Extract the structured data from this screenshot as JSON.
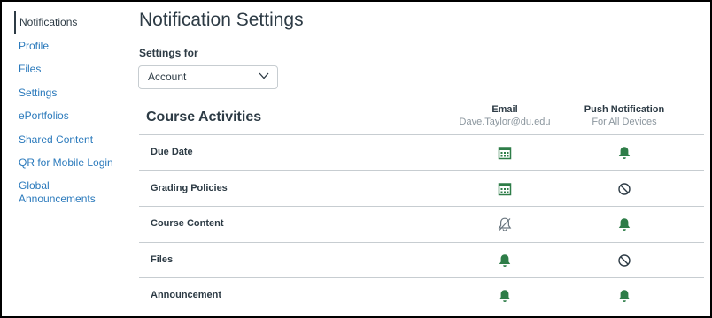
{
  "sidebar": {
    "items": [
      {
        "label": "Notifications",
        "active": true
      },
      {
        "label": "Profile"
      },
      {
        "label": "Files"
      },
      {
        "label": "Settings"
      },
      {
        "label": "ePortfolios"
      },
      {
        "label": "Shared Content"
      },
      {
        "label": "QR for Mobile Login"
      },
      {
        "label": "Global Announcements"
      }
    ]
  },
  "page": {
    "title": "Notification Settings",
    "settings_for_label": "Settings for",
    "settings_for_value": "Account"
  },
  "table": {
    "section_title": "Course Activities",
    "columns": [
      {
        "title": "Email",
        "subtitle": "Dave.Taylor@du.edu"
      },
      {
        "title": "Push Notification",
        "subtitle": "For All Devices"
      }
    ],
    "rows": [
      {
        "label": "Due Date",
        "email": "calendar-icon",
        "push": "bell-icon"
      },
      {
        "label": "Grading Policies",
        "email": "calendar-icon",
        "push": "disabled-icon"
      },
      {
        "label": "Course Content",
        "email": "bell-off-icon",
        "push": "bell-icon"
      },
      {
        "label": "Files",
        "email": "bell-icon",
        "push": "disabled-icon"
      },
      {
        "label": "Announcement",
        "email": "bell-icon",
        "push": "bell-icon"
      }
    ]
  },
  "colors": {
    "accent_green": "#2e7d48",
    "link_blue": "#2b7abc",
    "text": "#2d3b45",
    "muted": "#8b969e"
  }
}
